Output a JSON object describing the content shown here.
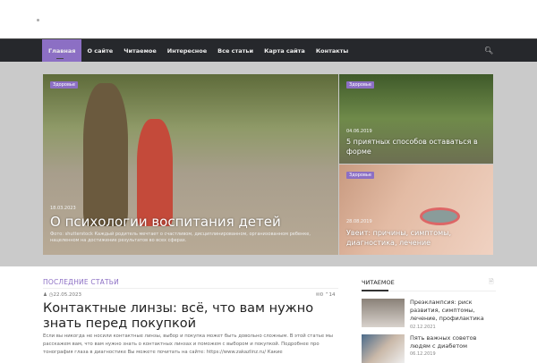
{
  "nav": {
    "items": [
      "Главная",
      "О сайте",
      "Читаемое",
      "Интересное",
      "Все статьи",
      "Карта сайта",
      "Контакты"
    ],
    "search_icon": "search-icon"
  },
  "hero": {
    "main": {
      "tag": "Здоровье",
      "date": "18.03.2023",
      "title": "О психологии воспитания детей",
      "excerpt": "Фото: shutterstock Каждый родитель мечтает о счастливом, дисциплинированном, организованном ребенке, нацеленном на достижение результатов во всех сферах."
    },
    "card1": {
      "tag": "Здоровье",
      "date": "04.06.2019",
      "title": "5 приятных способов оставаться в форме"
    },
    "card2": {
      "tag": "Здоровье",
      "date": "28.08.2019",
      "title": "Увеит: причины, симптомы, диагностика, лечение"
    }
  },
  "latest": {
    "section_title": "ПОСЛЕДНИЕ СТАТЬИ",
    "date": "22.05.2023",
    "comments": "0",
    "views": "14",
    "title": "Контактные линзы: всё, что вам нужно знать перед покупкой",
    "text": "Если вы никогда не носили контактные линзы, выбор и покупка может быть довольно сложным. В этой статье мы расскажем вам, что вам нужно знать о контактных линзах и поможем с выбором и покупкой. Подробнее про тонография глаза в диагностике Вы можете почитать на сайте: https://www.zakazlinz.ru/ Какие"
  },
  "sidebar": {
    "title": "ЧИТАЕМОЕ",
    "items": [
      {
        "title": "Преэклампсия: риск развития, симптомы, лечение, профилактика",
        "date": "02.12.2021"
      },
      {
        "title": "Пять важных советов людям с диабетом",
        "date": "06.12.2019"
      }
    ]
  },
  "colors": {
    "accent": "#8c6fc4",
    "nav_bg": "#26282c"
  }
}
